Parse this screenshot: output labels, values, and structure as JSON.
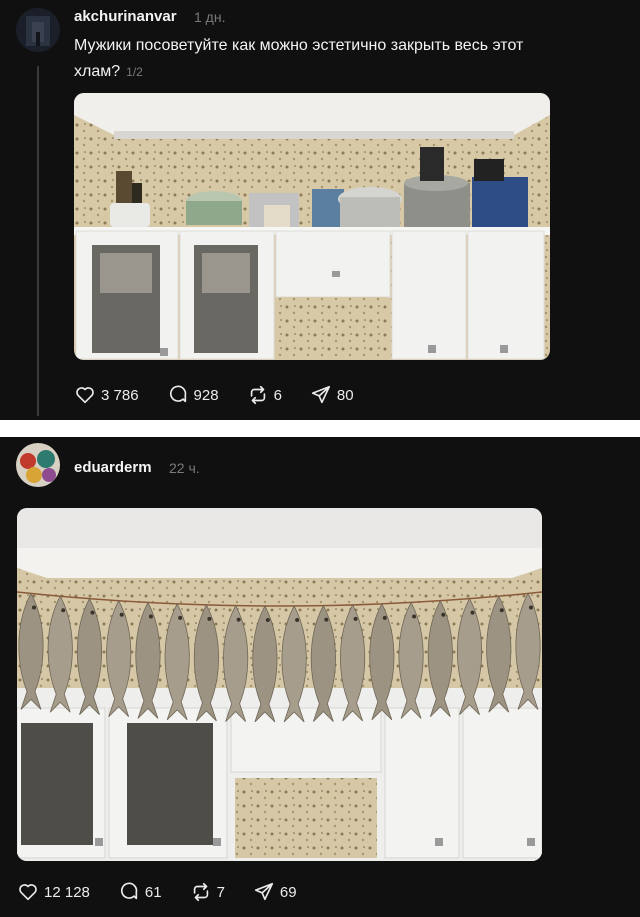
{
  "post1": {
    "username": "akchurinanvar",
    "time": "1 дн.",
    "text_line1": "Мужики посоветуйте как можно эстетично закрыть весь этот",
    "text_line2": "хлам?",
    "image_counter": "1/2",
    "likes": "3 786",
    "comments": "928",
    "reposts": "6",
    "shares": "80"
  },
  "post2": {
    "username": "eduarderm",
    "time": "22 ч.",
    "likes": "12 128",
    "comments": "61",
    "reposts": "7",
    "shares": "69"
  },
  "icons": [
    "heart-icon",
    "comment-icon",
    "repost-icon",
    "share-icon"
  ],
  "colors": {
    "background": "#101010",
    "muted": "#7a7a7a",
    "text": "#f3f3f3"
  }
}
